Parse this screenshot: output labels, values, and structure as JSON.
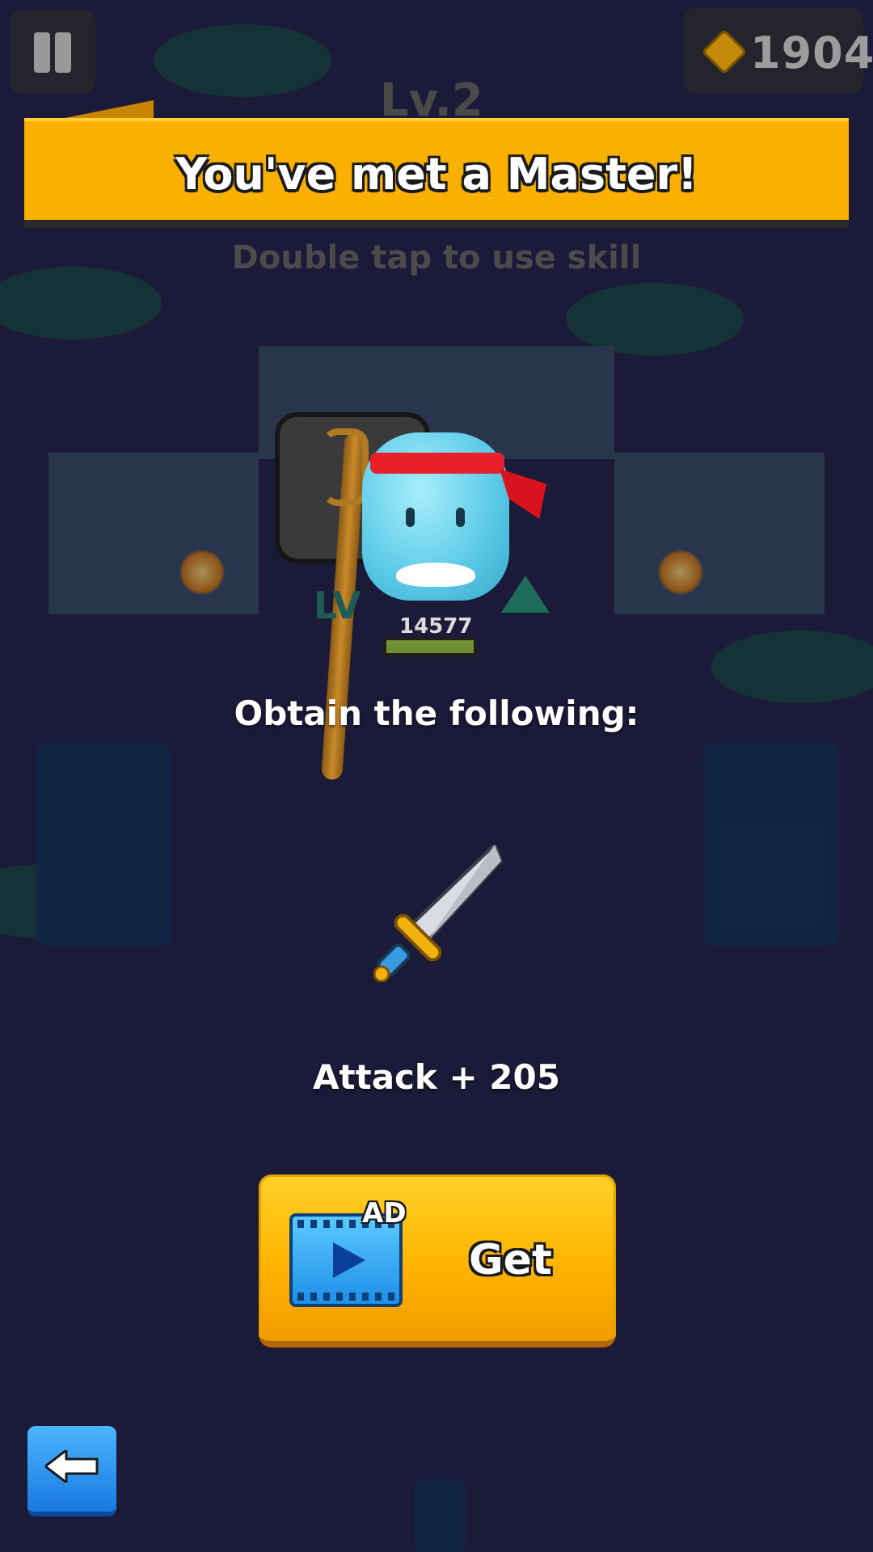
{
  "hud": {
    "currency_icon": "gem-icon",
    "currency_count": "1904",
    "level": "Lv.2"
  },
  "banner": {
    "title": "You've met a Master!",
    "hint": "Double tap to use skill"
  },
  "master": {
    "hp": "14577"
  },
  "reward": {
    "heading": "Obtain the following:",
    "item_icon": "sword-icon",
    "effect": "Attack + 205"
  },
  "actions": {
    "ad_badge": "AD",
    "get_label": "Get",
    "back_icon": "back-arrow-icon"
  },
  "colors": {
    "banner": "#f9b000",
    "get_button": "#ffb300",
    "back_button": "#2a8cf0"
  }
}
